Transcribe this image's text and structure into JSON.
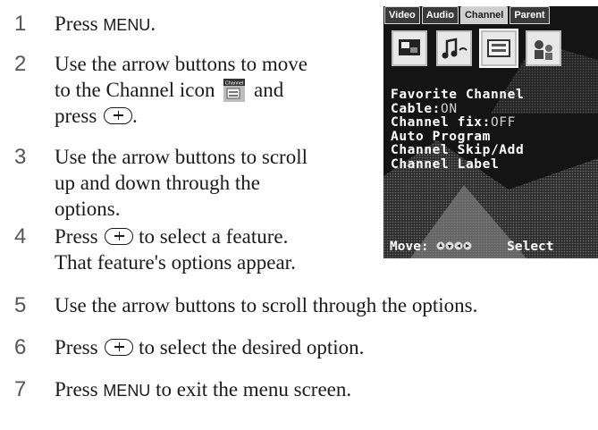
{
  "steps": [
    {
      "number": "1",
      "lines": [
        "Press MENU."
      ]
    },
    {
      "number": "2",
      "lines": [
        "Use the arrow buttons to move",
        "to the Channel icon",
        "and",
        "press",
        "."
      ]
    },
    {
      "number": "3",
      "lines": [
        "Use the arrow buttons to scroll",
        "up and down through the",
        "options."
      ]
    },
    {
      "number": "4",
      "lines": [
        "Press",
        "to select a feature.",
        "That feature's options appear."
      ]
    },
    {
      "number": "5",
      "lines": [
        "Use the arrow buttons to scroll through the options."
      ]
    },
    {
      "number": "6",
      "lines": [
        "Press",
        "to select the desired option."
      ]
    },
    {
      "number": "7",
      "lines": [
        "Press MENU to exit the menu screen."
      ]
    }
  ],
  "inline": {
    "press": "Press",
    "menu_key": "MENU",
    "step1_end": ".",
    "step7_rest": "to exit the menu screen."
  },
  "channel_icon_label": "Channel",
  "tv": {
    "tabs": [
      "Video",
      "Audio",
      "Channel",
      "Parent"
    ],
    "active_tab": "Channel",
    "menu_rows": [
      {
        "label": "Favorite Channel",
        "value": ""
      },
      {
        "label": "Cable:",
        "value": "ON"
      },
      {
        "label": "Channel fix:",
        "value": "OFF"
      },
      {
        "label": "Auto Program",
        "value": ""
      },
      {
        "label": "Channel Skip/Add",
        "value": ""
      },
      {
        "label": "Channel Label",
        "value": ""
      }
    ],
    "footer_move": "Move:",
    "footer_select": "Select"
  }
}
